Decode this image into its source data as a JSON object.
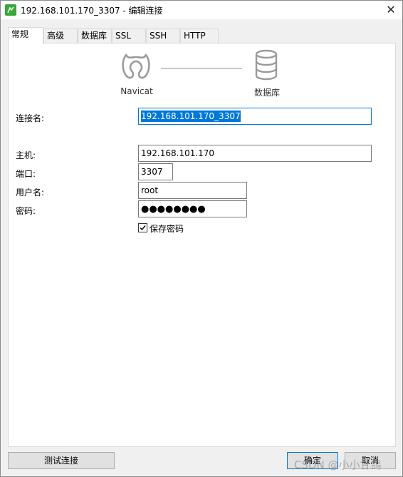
{
  "window": {
    "title": "192.168.101.170_3307 - 编辑连接",
    "close_glyph": "✕"
  },
  "tabs": [
    {
      "label": "常规",
      "active": true
    },
    {
      "label": "高级",
      "active": false
    },
    {
      "label": "数据库",
      "active": false
    },
    {
      "label": "SSL",
      "active": false
    },
    {
      "label": "SSH",
      "active": false
    },
    {
      "label": "HTTP",
      "active": false
    }
  ],
  "diagram": {
    "left_label": "Navicat",
    "left_icon": "navicat-logo-icon",
    "right_label": "数据库",
    "right_icon": "database-icon"
  },
  "form": {
    "connection_name": {
      "label": "连接名:",
      "value": "192.168.101.170_3307"
    },
    "host": {
      "label": "主机:",
      "value": "192.168.101.170"
    },
    "port": {
      "label": "端口:",
      "value": "3307"
    },
    "username": {
      "label": "用户名:",
      "value": "root"
    },
    "password": {
      "label": "密码:",
      "value": "●●●●●●●●"
    },
    "save_password": {
      "label": "保存密码",
      "checked": true
    }
  },
  "buttons": {
    "test": "测试连接",
    "ok": "确定",
    "cancel": "取消"
  },
  "watermark": "CSDN @小小甘鸽",
  "colors": {
    "accent": "#0078d7",
    "app_icon": "#36a836",
    "window_bg": "#f0f0f0"
  }
}
